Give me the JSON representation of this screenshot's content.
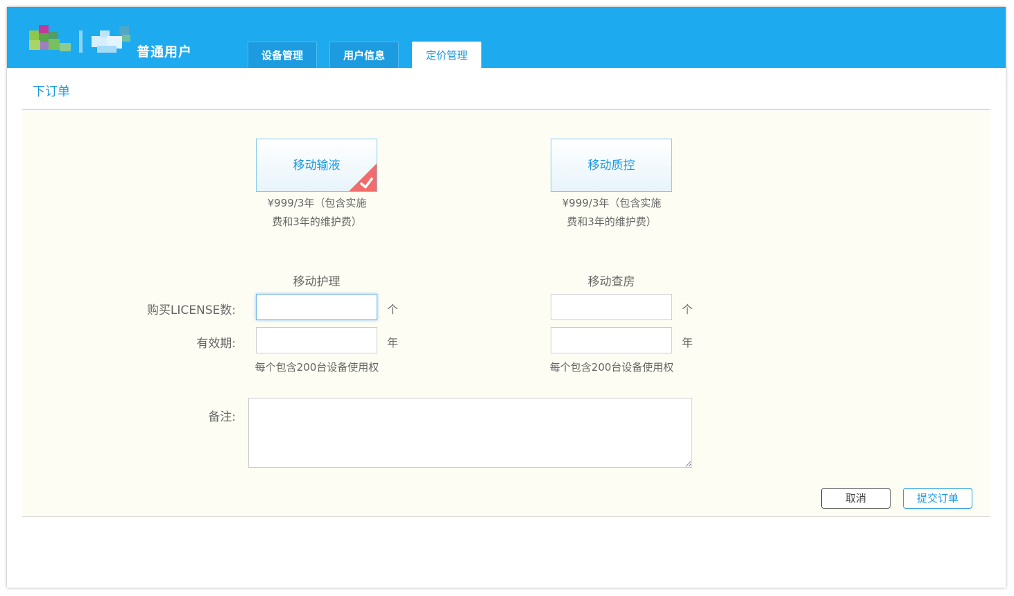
{
  "header": {
    "user_type": "普通用户",
    "tabs": [
      {
        "label": "设备管理"
      },
      {
        "label": "用户信息"
      },
      {
        "label": "定价管理"
      }
    ],
    "active_tab": "定价管理"
  },
  "section": {
    "title": "下订单"
  },
  "products": [
    {
      "name": "移动输液",
      "price_line1": "¥999/3年（包含实施",
      "price_line2": "费和3年的维护费）",
      "selected": true
    },
    {
      "name": "移动质控",
      "price_line1": "¥999/3年（包含实施",
      "price_line2": "费和3年的维护费）",
      "selected": false
    }
  ],
  "form": {
    "columns": [
      {
        "heading": "移动护理",
        "license_unit": "个",
        "years_unit": "年",
        "note": "每个包含200台设备使用权",
        "license_value": "",
        "years_value": ""
      },
      {
        "heading": "移动查房",
        "license_unit": "个",
        "years_unit": "年",
        "note": "每个包含200台设备使用权",
        "license_value": "",
        "years_value": ""
      }
    ],
    "license_label": "购买LICENSE数:",
    "validity_label": "有效期:",
    "remarks_label": "备注:",
    "remarks_value": ""
  },
  "actions": {
    "cancel_label": "取消",
    "submit_label": "提交订单"
  },
  "colors": {
    "header_blue": "#1eaaee",
    "accent_blue": "#1c9be0",
    "panel_bg": "#fdfdf3",
    "check_red": "#f06d6d"
  }
}
